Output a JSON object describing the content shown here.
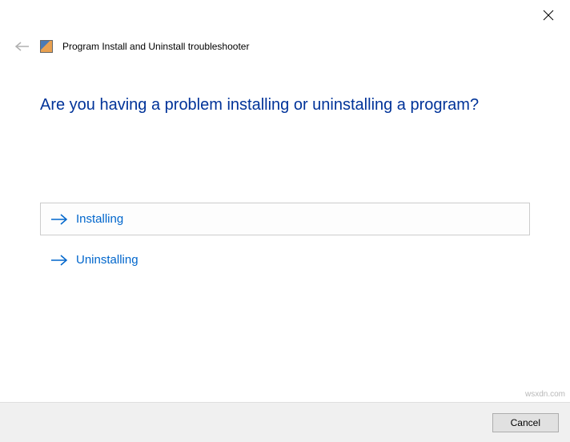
{
  "header": {
    "title": "Program Install and Uninstall troubleshooter"
  },
  "main": {
    "question": "Are you having a problem installing or uninstalling a program?",
    "options": [
      {
        "label": "Installing"
      },
      {
        "label": "Uninstalling"
      }
    ]
  },
  "footer": {
    "cancel_label": "Cancel"
  },
  "watermark": "wsxdn.com"
}
